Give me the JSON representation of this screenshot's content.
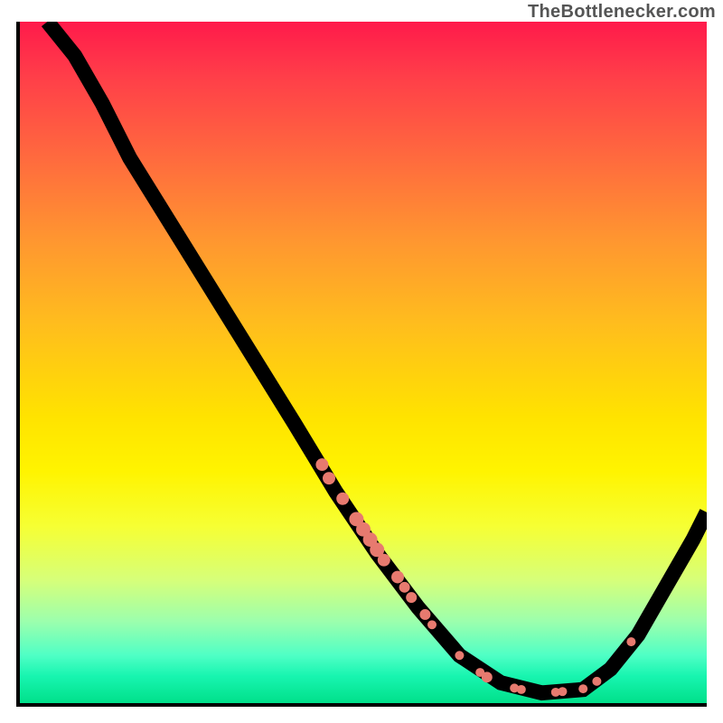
{
  "watermark": "TheBottlenecker.com",
  "chart_data": {
    "type": "line",
    "title": "",
    "xlabel": "",
    "ylabel": "",
    "xlim": [
      0,
      100
    ],
    "ylim": [
      0,
      100
    ],
    "line": [
      {
        "x": 4,
        "y": 100
      },
      {
        "x": 8,
        "y": 95
      },
      {
        "x": 12,
        "y": 88
      },
      {
        "x": 16,
        "y": 80
      },
      {
        "x": 24,
        "y": 67
      },
      {
        "x": 32,
        "y": 54
      },
      {
        "x": 40,
        "y": 41
      },
      {
        "x": 46,
        "y": 31
      },
      {
        "x": 52,
        "y": 22
      },
      {
        "x": 58,
        "y": 14
      },
      {
        "x": 64,
        "y": 7
      },
      {
        "x": 70,
        "y": 3
      },
      {
        "x": 76,
        "y": 1.5
      },
      {
        "x": 82,
        "y": 2
      },
      {
        "x": 86,
        "y": 5
      },
      {
        "x": 90,
        "y": 10
      },
      {
        "x": 94,
        "y": 17
      },
      {
        "x": 98,
        "y": 24
      },
      {
        "x": 100,
        "y": 28
      }
    ],
    "markers": [
      {
        "x": 44,
        "y": 35,
        "r": 7
      },
      {
        "x": 45,
        "y": 33,
        "r": 7
      },
      {
        "x": 47,
        "y": 30,
        "r": 7
      },
      {
        "x": 49,
        "y": 27,
        "r": 8
      },
      {
        "x": 50,
        "y": 25.5,
        "r": 8
      },
      {
        "x": 51,
        "y": 24,
        "r": 8
      },
      {
        "x": 52,
        "y": 22.5,
        "r": 8
      },
      {
        "x": 53,
        "y": 21,
        "r": 7
      },
      {
        "x": 55,
        "y": 18.5,
        "r": 7
      },
      {
        "x": 56,
        "y": 17,
        "r": 6
      },
      {
        "x": 57,
        "y": 15.5,
        "r": 6
      },
      {
        "x": 59,
        "y": 13,
        "r": 6
      },
      {
        "x": 60,
        "y": 11.5,
        "r": 5
      },
      {
        "x": 64,
        "y": 7,
        "r": 5
      },
      {
        "x": 67,
        "y": 4.5,
        "r": 5
      },
      {
        "x": 68,
        "y": 3.8,
        "r": 6
      },
      {
        "x": 72,
        "y": 2.2,
        "r": 5
      },
      {
        "x": 73,
        "y": 2,
        "r": 5
      },
      {
        "x": 78,
        "y": 1.6,
        "r": 5
      },
      {
        "x": 79,
        "y": 1.7,
        "r": 5
      },
      {
        "x": 82,
        "y": 2.1,
        "r": 5
      },
      {
        "x": 84,
        "y": 3.2,
        "r": 5
      },
      {
        "x": 89,
        "y": 9,
        "r": 5
      }
    ]
  }
}
